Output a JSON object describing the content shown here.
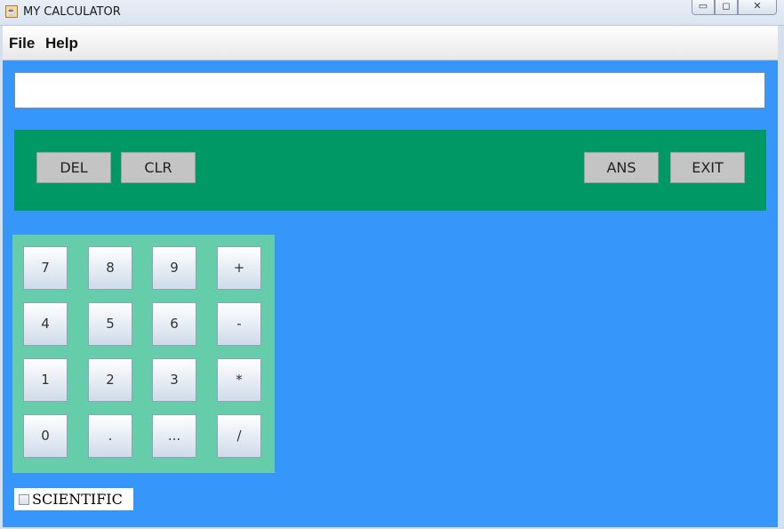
{
  "window": {
    "title": "MY CALCULATOR",
    "icon": "java-cup-icon",
    "controls": {
      "minimize": "▭",
      "restore": "◻",
      "close": "✕"
    }
  },
  "menubar": {
    "items": [
      {
        "label": "File"
      },
      {
        "label": "Help"
      }
    ]
  },
  "display": {
    "value": ""
  },
  "controls": {
    "del": "DEL",
    "clr": "CLR",
    "ans": "ANS",
    "exit": "EXIT"
  },
  "keypad": {
    "keys": [
      "7",
      "8",
      "9",
      "+",
      "4",
      "5",
      "6",
      "-",
      "1",
      "2",
      "3",
      "*",
      "0",
      ".",
      "...",
      "/"
    ]
  },
  "scientific": {
    "label": "SCIENTIFIC",
    "checked": false
  },
  "colors": {
    "background": "#3796fa",
    "control_panel": "#009865",
    "keypad_panel": "#66cdaa",
    "control_button": "#c4c4c4"
  }
}
